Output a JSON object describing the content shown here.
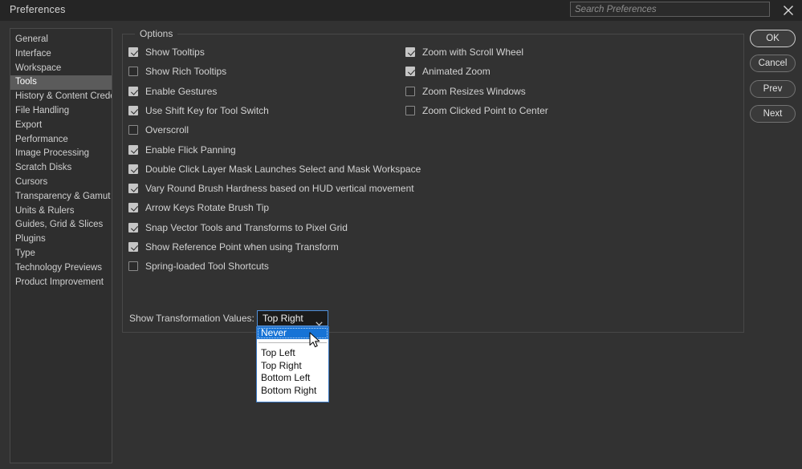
{
  "window": {
    "title": "Preferences",
    "close_icon": "close-icon"
  },
  "search": {
    "placeholder": "Search Preferences",
    "value": ""
  },
  "sidebar": {
    "items": [
      {
        "label": "General",
        "selected": false
      },
      {
        "label": "Interface",
        "selected": false
      },
      {
        "label": "Workspace",
        "selected": false
      },
      {
        "label": "Tools",
        "selected": true
      },
      {
        "label": "History & Content Credentials",
        "selected": false
      },
      {
        "label": "File Handling",
        "selected": false
      },
      {
        "label": "Export",
        "selected": false
      },
      {
        "label": "Performance",
        "selected": false
      },
      {
        "label": "Image Processing",
        "selected": false
      },
      {
        "label": "Scratch Disks",
        "selected": false
      },
      {
        "label": "Cursors",
        "selected": false
      },
      {
        "label": "Transparency & Gamut",
        "selected": false
      },
      {
        "label": "Units & Rulers",
        "selected": false
      },
      {
        "label": "Guides, Grid & Slices",
        "selected": false
      },
      {
        "label": "Plugins",
        "selected": false
      },
      {
        "label": "Type",
        "selected": false
      },
      {
        "label": "Technology Previews",
        "selected": false
      },
      {
        "label": "Product Improvement",
        "selected": false
      }
    ]
  },
  "options": {
    "legend": "Options",
    "left_column": [
      {
        "label": "Show Tooltips",
        "checked": true
      },
      {
        "label": "Show Rich Tooltips",
        "checked": false
      },
      {
        "label": "Enable Gestures",
        "checked": true
      },
      {
        "label": "Use Shift Key for Tool Switch",
        "checked": true
      },
      {
        "label": "Overscroll",
        "checked": false
      },
      {
        "label": "Enable Flick Panning",
        "checked": true
      },
      {
        "label": "Double Click Layer Mask Launches Select and Mask Workspace",
        "checked": true
      },
      {
        "label": "Vary Round Brush Hardness based on HUD vertical movement",
        "checked": true
      },
      {
        "label": "Arrow Keys Rotate Brush Tip",
        "checked": true
      },
      {
        "label": "Snap Vector Tools and Transforms to Pixel Grid",
        "checked": true
      },
      {
        "label": "Show Reference Point when using Transform",
        "checked": true
      },
      {
        "label": "Spring-loaded Tool Shortcuts",
        "checked": false
      }
    ],
    "right_column": [
      {
        "label": "Zoom with Scroll Wheel",
        "checked": true
      },
      {
        "label": "Animated Zoom",
        "checked": true
      },
      {
        "label": "Zoom Resizes Windows",
        "checked": false
      },
      {
        "label": "Zoom Clicked Point to Center",
        "checked": false
      }
    ]
  },
  "transformation": {
    "label": "Show Transformation Values:",
    "selected": "Top Right",
    "dropdown_open": true,
    "highlighted": "Never",
    "options": [
      "Never",
      "Top Left",
      "Top Right",
      "Bottom Left",
      "Bottom Right"
    ]
  },
  "buttons": {
    "ok": "OK",
    "cancel": "Cancel",
    "prev": "Prev",
    "next": "Next"
  },
  "colors": {
    "window_bg": "#323232",
    "titlebar_bg": "#252525",
    "sidebar_bg": "#2e2e2e",
    "selection": "#5b5b5b",
    "accent_blue": "#1673d6",
    "focus_border": "#4f8fd8",
    "text": "#d2d2d2"
  }
}
